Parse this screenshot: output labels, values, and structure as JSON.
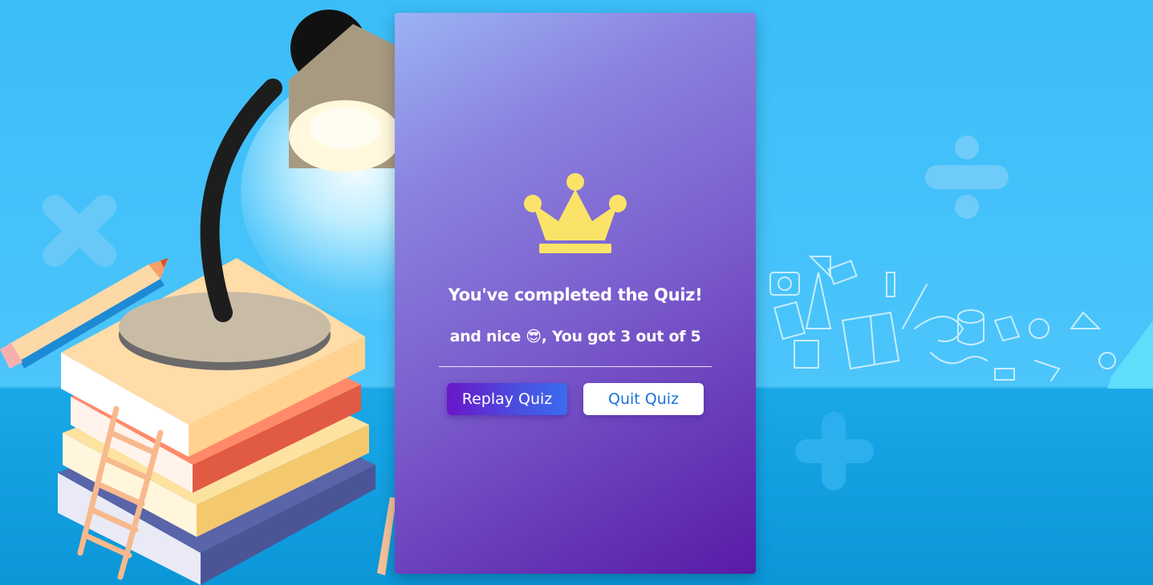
{
  "result": {
    "title": "You've completed the Quiz!",
    "score_prefix": "and nice",
    "score_emoji": "😎",
    "score_suffix": ", You got 3 out of 5",
    "score_value": 3,
    "score_total": 5
  },
  "buttons": {
    "replay_label": "Replay Quiz",
    "quit_label": "Quit Quiz"
  },
  "icons": {
    "crown": "crown-icon",
    "times": "multiply-symbol-icon",
    "divide": "divide-symbol-icon",
    "plus": "plus-symbol-icon"
  },
  "colors": {
    "background": "#3bbdf8",
    "floor": "#0b96d8",
    "card_top": "#9bb2f5",
    "card_bottom": "#5a1aa6",
    "crown": "#fbe36a",
    "replay_button": "#6a16c9",
    "quit_text": "#1a73d9"
  }
}
